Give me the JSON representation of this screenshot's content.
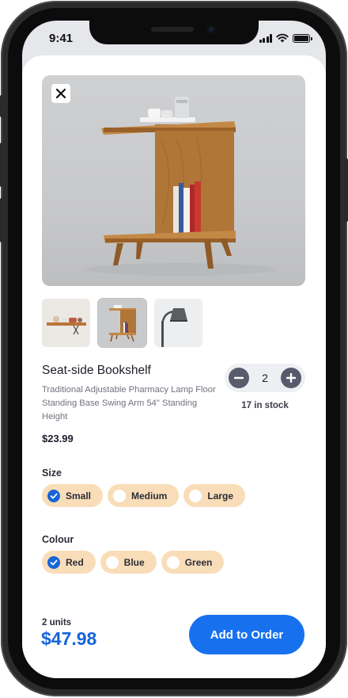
{
  "status_bar": {
    "time": "9:41"
  },
  "product": {
    "title": "Seat-side Bookshelf",
    "description": "Traditional Adjustable Pharmacy Lamp Floor Standing Base Swing Arm 54\" Standing Height",
    "price": "$23.99",
    "hero_image": "side-table-bookshelf",
    "thumbnails": [
      {
        "name": "wall-shelf",
        "selected": false
      },
      {
        "name": "side-table-bookshelf",
        "selected": true
      },
      {
        "name": "desk-lamp",
        "selected": false
      }
    ]
  },
  "quantity": {
    "value": "2",
    "minus_icon": "minus",
    "plus_icon": "plus",
    "stock": "17 in stock"
  },
  "size": {
    "label": "Size",
    "options": [
      {
        "label": "Small",
        "selected": true
      },
      {
        "label": "Medium",
        "selected": false
      },
      {
        "label": "Large",
        "selected": false
      }
    ]
  },
  "colour": {
    "label": "Colour",
    "options": [
      {
        "label": "Red",
        "selected": true
      },
      {
        "label": "Blue",
        "selected": false
      },
      {
        "label": "Green",
        "selected": false
      }
    ]
  },
  "summary": {
    "units": "2  units",
    "total": "$47.98",
    "cta": "Add to Order"
  },
  "colors": {
    "accent": "#1771ef",
    "chip": "#f9ddb8",
    "total": "#1565d8"
  }
}
